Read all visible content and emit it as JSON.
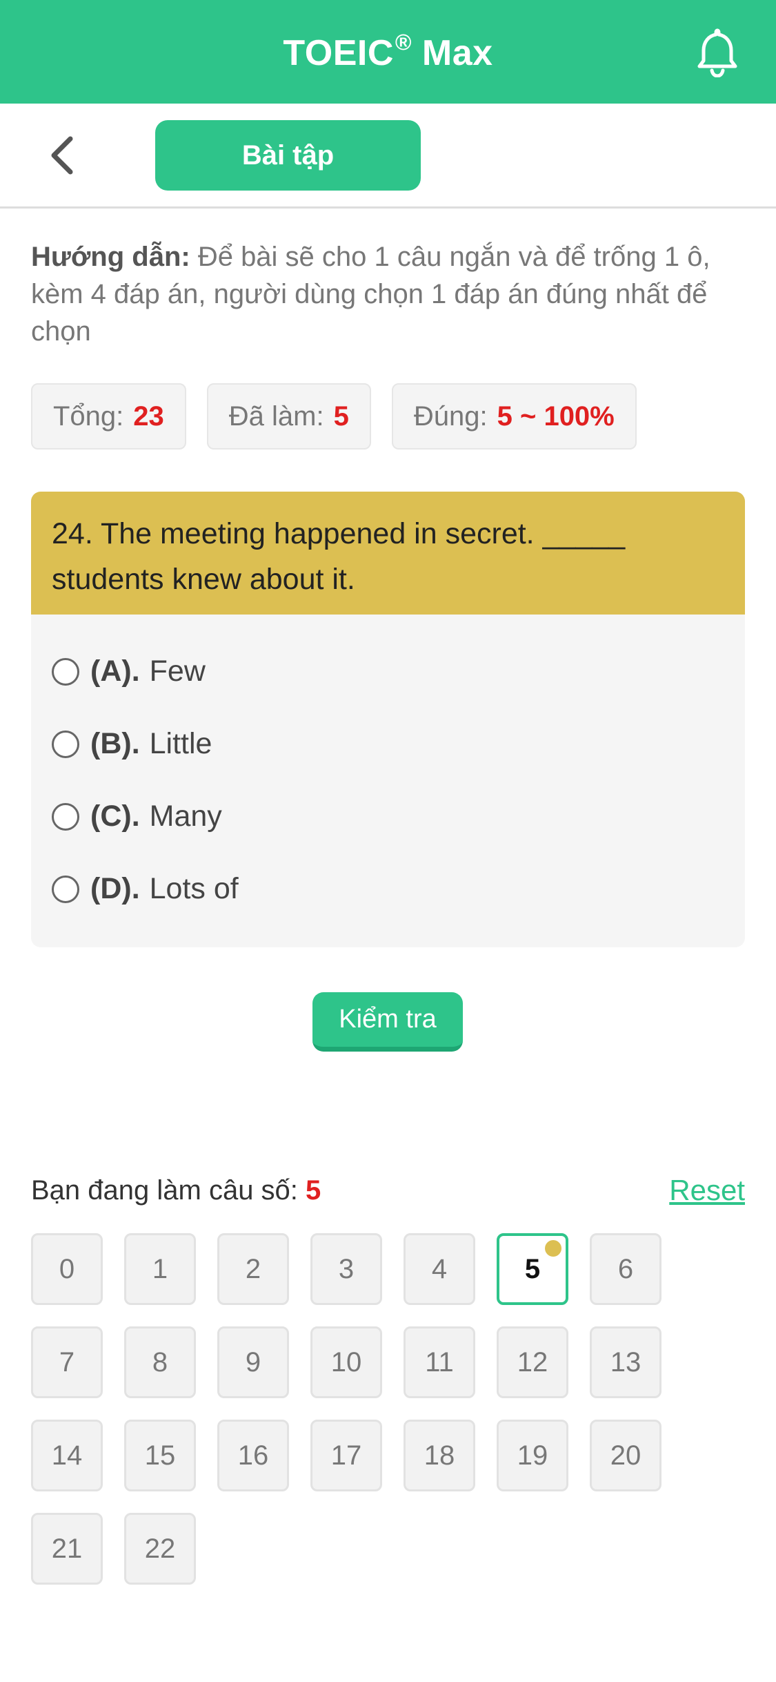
{
  "header": {
    "title": "TOEIC",
    "title_mark": "®",
    "title_suffix": " Max",
    "bell_icon": "bell-icon",
    "color": "#2ec48a"
  },
  "subbar": {
    "back_icon": "chevron-left-icon",
    "tab_label": "Bài tập"
  },
  "instructions": {
    "label": "Hướng dẫn:",
    "text": " Để bài sẽ cho 1 câu ngắn và để trống 1 ô, kèm 4 đáp án, người dùng chọn 1 đáp án đúng nhất để chọn"
  },
  "stats": {
    "total_label": "Tổng:",
    "total_value": "23",
    "done_label": "Đã làm:",
    "done_value": "5",
    "correct_label": "Đúng:",
    "correct_value": "5 ~ 100%"
  },
  "question": {
    "text": "24. The meeting happened in secret. _____ students knew about it.",
    "options": [
      {
        "key": "(A).",
        "text": "Few"
      },
      {
        "key": "(B).",
        "text": "Little"
      },
      {
        "key": "(C).",
        "text": "Many"
      },
      {
        "key": "(D).",
        "text": "Lots of"
      }
    ]
  },
  "check_button": "Kiểm tra",
  "progress": {
    "label": "Bạn đang làm câu số: ",
    "current": "5",
    "reset": "Reset",
    "numbers": [
      "0",
      "1",
      "2",
      "3",
      "4",
      "5",
      "6",
      "7",
      "8",
      "9",
      "10",
      "11",
      "12",
      "13",
      "14",
      "15",
      "16",
      "17",
      "18",
      "19",
      "20",
      "21",
      "22"
    ],
    "active_index": 5
  }
}
